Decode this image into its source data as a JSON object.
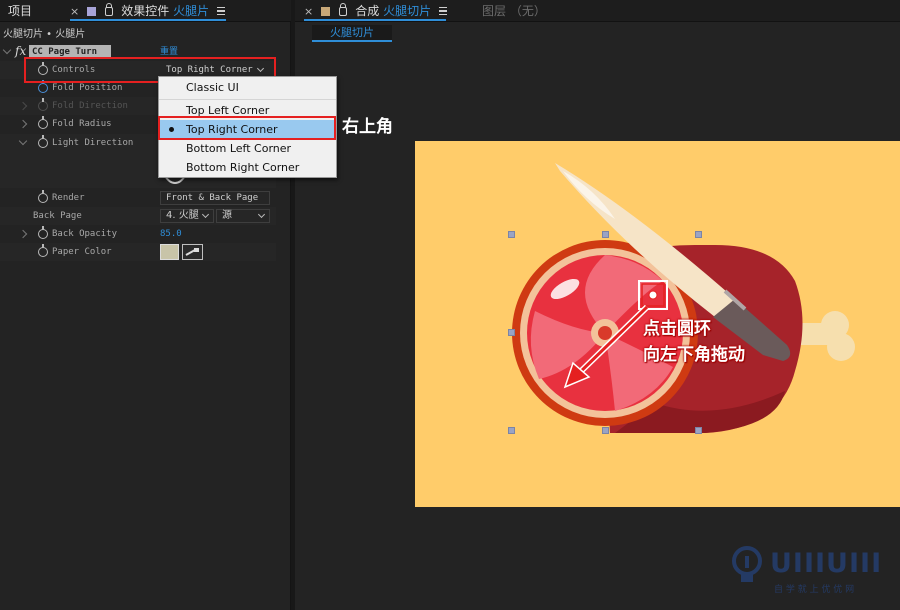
{
  "tabs": {
    "project": "项目",
    "effect_controls_prefix": "效果控件",
    "effect_controls_layer": "火腿片",
    "composition_prefix": "合成",
    "composition_name": "火腿切片",
    "layer_none": "图层 （无）"
  },
  "left_panel": {
    "breadcrumb": "火腿切片 • 火腿片",
    "effect_name": "CC Page Turn",
    "reset_label": "重置",
    "rows": {
      "controls": {
        "label": "Controls",
        "value": "Top Right Corner"
      },
      "fold_position": {
        "label": "Fold Position"
      },
      "fold_direction": {
        "label": "Fold Direction"
      },
      "fold_radius": {
        "label": "Fold Radius"
      },
      "light_direction": {
        "label": "Light Direction"
      },
      "render": {
        "label": "Render",
        "value": "Front & Back Page"
      },
      "back_page": {
        "label": "Back Page",
        "layer_value": "4. 火腿",
        "source_value": "源"
      },
      "back_opacity": {
        "label": "Back Opacity",
        "value": "85.0"
      },
      "paper_color": {
        "label": "Paper Color"
      }
    }
  },
  "dropdown": {
    "items": [
      {
        "label": "Classic UI",
        "selected": false
      },
      {
        "label": "Top Left Corner",
        "selected": false
      },
      {
        "label": "Top Right Corner",
        "selected": true
      },
      {
        "label": "Bottom Left Corner",
        "selected": false
      },
      {
        "label": "Bottom Right Corner",
        "selected": false
      }
    ]
  },
  "annotations": {
    "top_right_corner_cn": "右上角",
    "drag_line1": "点击圆环",
    "drag_line2": "向左下角拖动"
  },
  "comp_tab": {
    "label": "火腿切片"
  },
  "watermark": {
    "brand": "UIIIUIII",
    "tagline": "自 学 就 上 优 优 网"
  },
  "colors": {
    "accent_blue": "#2f8ed8",
    "annotation_red": "#e52020",
    "canvas_bg": "#ffcc6a",
    "paper_swatch": "#c8c4a8",
    "menu_highlight": "#99c9ef"
  }
}
